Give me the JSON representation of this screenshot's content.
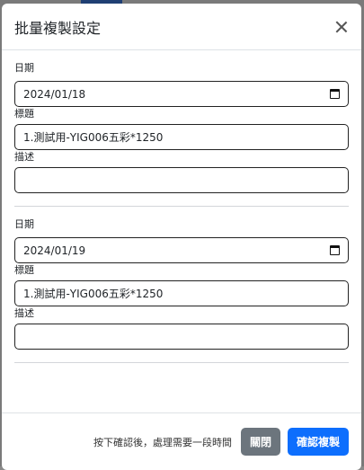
{
  "modal": {
    "title": "批量複製設定",
    "close_icon": "close-icon"
  },
  "entries": [
    {
      "date_label": "日期",
      "date_value": "2024/01/18",
      "title_label": "標題",
      "title_value": "1.測試用-YIG006五彩*1250",
      "desc_label": "描述",
      "desc_value": ""
    },
    {
      "date_label": "日期",
      "date_value": "2024/01/19",
      "title_label": "標題",
      "title_value": "1.測試用-YIG006五彩*1250",
      "desc_label": "描述",
      "desc_value": ""
    }
  ],
  "footer": {
    "note": "按下確認後，處理需要一段時間",
    "close_label": "關閉",
    "confirm_label": "確認複製"
  },
  "colors": {
    "primary": "#0d6efd",
    "secondary": "#6c757d"
  }
}
